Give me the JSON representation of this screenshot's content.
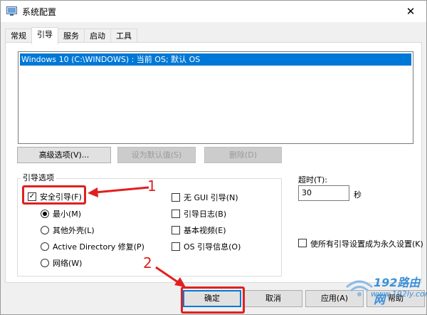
{
  "window": {
    "title": "系统配置",
    "close_glyph": "✕"
  },
  "tabs": [
    {
      "label": "常规",
      "active": false
    },
    {
      "label": "引导",
      "active": true
    },
    {
      "label": "服务",
      "active": false
    },
    {
      "label": "启动",
      "active": false
    },
    {
      "label": "工具",
      "active": false
    }
  ],
  "os_list": {
    "items": [
      "Windows 10 (C:\\WINDOWS) : 当前 OS; 默认 OS"
    ],
    "selected_index": 0
  },
  "buttons": {
    "advanced": "高级选项(V)...",
    "set_default": "设为默认值(S)",
    "delete": "删除(D)"
  },
  "boot_options": {
    "legend": "引导选项",
    "safe_boot": {
      "label": "安全引导(F)",
      "checked": true
    },
    "radios": [
      {
        "label": "最小(M)",
        "checked": true
      },
      {
        "label": "其他外壳(L)",
        "checked": false
      },
      {
        "label": "Active Directory 修复(P)",
        "checked": false
      },
      {
        "label": "网络(W)",
        "checked": false
      }
    ],
    "right_checks": [
      {
        "label": "无 GUI 引导(N)",
        "checked": false
      },
      {
        "label": "引导日志(B)",
        "checked": false
      },
      {
        "label": "基本视频(E)",
        "checked": false
      },
      {
        "label": "OS 引导信息(O)",
        "checked": false
      }
    ]
  },
  "timeout": {
    "label": "超时(T):",
    "value": "30",
    "unit": "秒"
  },
  "permanent": {
    "label": "使所有引导设置成为永久设置(K)",
    "checked": false
  },
  "bottom_buttons": {
    "ok": "确定",
    "cancel": "取消",
    "apply": "应用(A)",
    "help": "帮助"
  },
  "annotations": {
    "step1": "1",
    "step2": "2",
    "color": "#e02020"
  },
  "watermark": {
    "text": "192路由网",
    "sub": "www.192ly.com"
  },
  "colors": {
    "accent": "#0078d7",
    "annotation": "#e02020",
    "watermark": "#3b8fd8"
  }
}
